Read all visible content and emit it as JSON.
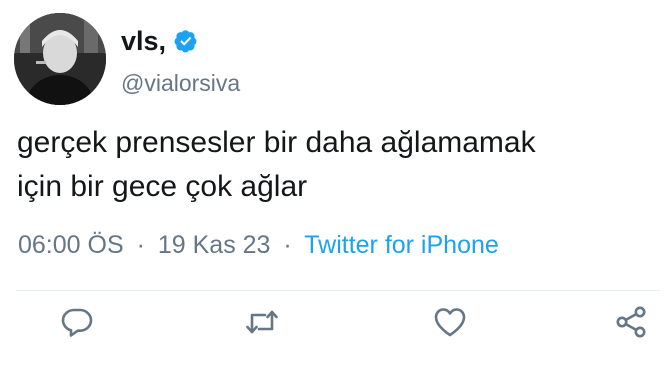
{
  "user": {
    "display_name": "vls,",
    "handle": "@vialorsiva",
    "verified": true
  },
  "tweet": {
    "text_lines": [
      "gerçek prensesler bir daha ağlamamak",
      "için bir gece çok ağlar"
    ],
    "time": "06:00 ÖS",
    "separator": "·",
    "date": "19 Kas 23",
    "source": "Twitter for iPhone"
  },
  "actions": {
    "reply_icon": "reply-icon",
    "retweet_icon": "retweet-icon",
    "like_icon": "heart-icon",
    "share_icon": "share-icon"
  },
  "colors": {
    "text": "#14171a",
    "muted": "#657786",
    "link": "#1da1f2",
    "verified": "#1da1f2"
  }
}
